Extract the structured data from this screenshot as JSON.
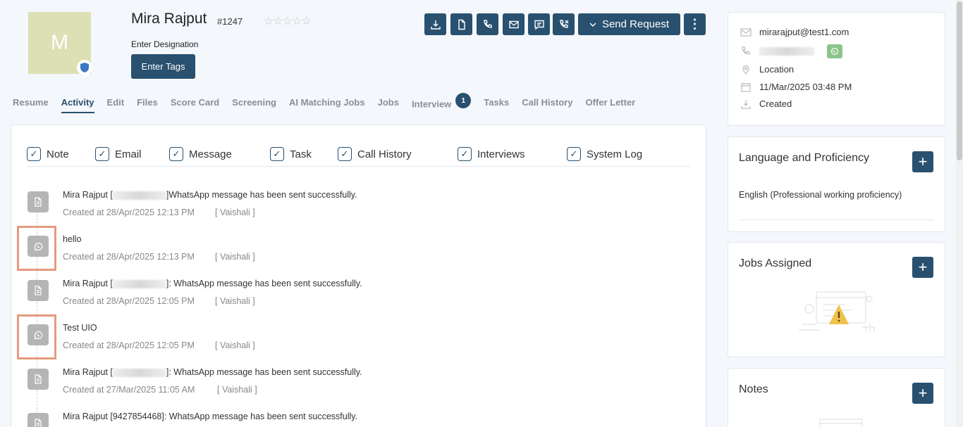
{
  "candidate": {
    "avatar_initial": "M",
    "name": "Mira Rajput",
    "id": "#1247",
    "stars": "☆☆☆☆☆",
    "designation": "Enter Designation",
    "tags_button": "Enter Tags"
  },
  "toolbar": {
    "icons": [
      "download-icon",
      "document-icon",
      "phone-icon",
      "mail-icon",
      "chat-icon",
      "call-log-icon"
    ],
    "send_request": "Send Request",
    "more": "⋮"
  },
  "tabs": [
    {
      "label": "Resume"
    },
    {
      "label": "Activity",
      "active": true
    },
    {
      "label": "Edit"
    },
    {
      "label": "Files"
    },
    {
      "label": "Score Card"
    },
    {
      "label": "Screening"
    },
    {
      "label": "AI Matching Jobs"
    },
    {
      "label": "Jobs"
    },
    {
      "label": "Interview",
      "badge": "1"
    },
    {
      "label": "Tasks"
    },
    {
      "label": "Call History"
    },
    {
      "label": "Offer Letter"
    }
  ],
  "filters": [
    "Note",
    "Email",
    "Message",
    "Task",
    "Call History",
    "Interviews",
    "System Log"
  ],
  "activities": [
    {
      "icon": "document-icon",
      "pre": "Mira Rajput [",
      "post": "]WhatsApp message has been sent successfully.",
      "created": "Created at 28/Apr/2025 12:13 PM",
      "by": "[ Vaishali ]",
      "highlight": false
    },
    {
      "icon": "whatsapp-icon",
      "text": "hello",
      "created": "Created at 28/Apr/2025 12:13 PM",
      "by": "[ Vaishali ]",
      "highlight": true
    },
    {
      "icon": "document-icon",
      "pre": "Mira Rajput [",
      "post": "]: WhatsApp message has been sent successfully.",
      "created": "Created at 28/Apr/2025 12:05 PM",
      "by": "[ Vaishali ]",
      "highlight": false
    },
    {
      "icon": "whatsapp-icon",
      "text": "Test UIO",
      "created": "Created at 28/Apr/2025 12:05 PM",
      "by": "[ Vaishali ]",
      "highlight": true
    },
    {
      "icon": "document-icon",
      "pre": "Mira Rajput [",
      "post": "]: WhatsApp message has been sent successfully.",
      "created": "Created at 27/Mar/2025 11:05 AM",
      "by": "[ Vaishali ]",
      "highlight": false
    },
    {
      "icon": "document-icon",
      "text": "Mira Rajput [9427854468]: WhatsApp message has been sent successfully.",
      "created": "",
      "by": "",
      "highlight": false
    }
  ],
  "contact": {
    "email": "mirarajput@test1.com",
    "location": "Location",
    "date": "11/Mar/2025 03:48 PM",
    "source": "Created"
  },
  "language": {
    "title": "Language and Proficiency",
    "value": "English (Professional working proficiency)"
  },
  "jobs": {
    "title": "Jobs Assigned"
  },
  "notes": {
    "title": "Notes"
  },
  "colors": {
    "primary": "#29506f",
    "highlight": "#e59a7c",
    "whatsapp": "#8bc48a"
  }
}
